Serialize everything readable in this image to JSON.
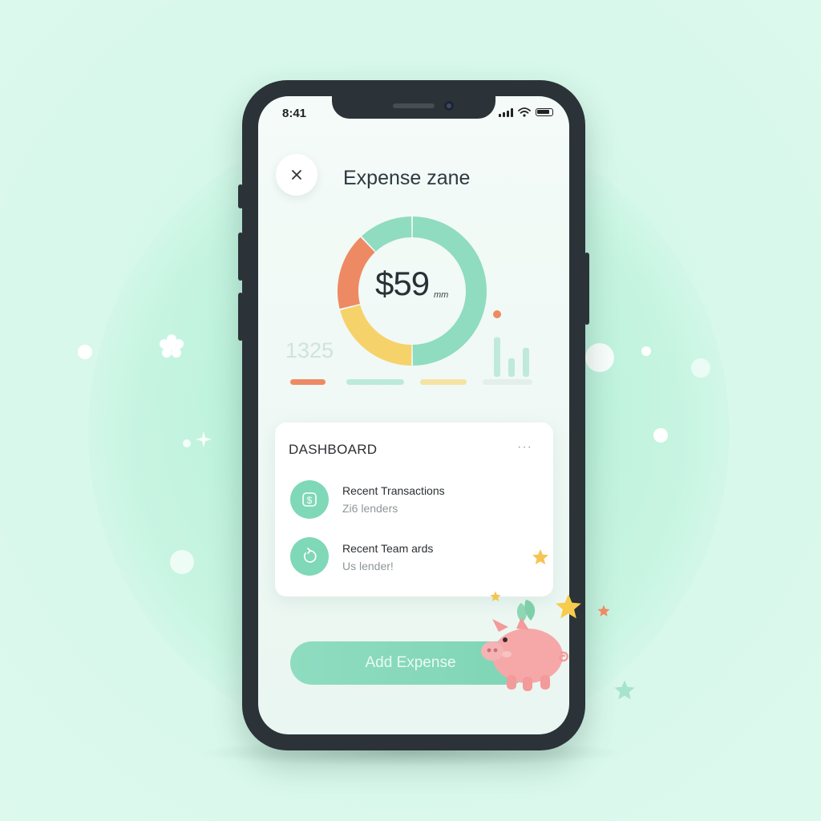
{
  "status_bar": {
    "time": "8:41"
  },
  "header": {
    "title": "Expense zane"
  },
  "summary": {
    "amount": "$59",
    "amount_unit": "mm",
    "secondary_value": "1325"
  },
  "chart_data": {
    "type": "pie",
    "donut": true,
    "slices": [
      {
        "value": 50,
        "color": "#8fdcc0"
      },
      {
        "value": 21,
        "color": "#f6d26a"
      },
      {
        "value": 17,
        "color": "#ee8a63"
      },
      {
        "value": 12,
        "color": "#8fdcc0"
      }
    ],
    "center_label": "$59"
  },
  "mini_bars": {
    "values": [
      0.75,
      0.35,
      0.55
    ],
    "dot_color": "#ee8a63",
    "bar_color": "#bfeadb"
  },
  "legend_bars": [
    {
      "color": "#ee8a63"
    },
    {
      "color": "#bde9db"
    },
    {
      "color": "#f6e3a4"
    },
    {
      "color": "#e3efea"
    }
  ],
  "dashboard": {
    "title": "DASHBOARD",
    "menu": "···",
    "items": [
      {
        "icon": "dollar-icon",
        "title": "Recent Transactions",
        "subtitle": "Zi6 lenders"
      },
      {
        "icon": "refresh-icon",
        "title": "Recent Team ards",
        "subtitle": "Us lender!"
      }
    ]
  },
  "actions": {
    "add_expense": "Add Expense"
  },
  "colors": {
    "accent": "#7fd5b6",
    "background": "#d6f8ea",
    "frame": "#2b3238"
  }
}
